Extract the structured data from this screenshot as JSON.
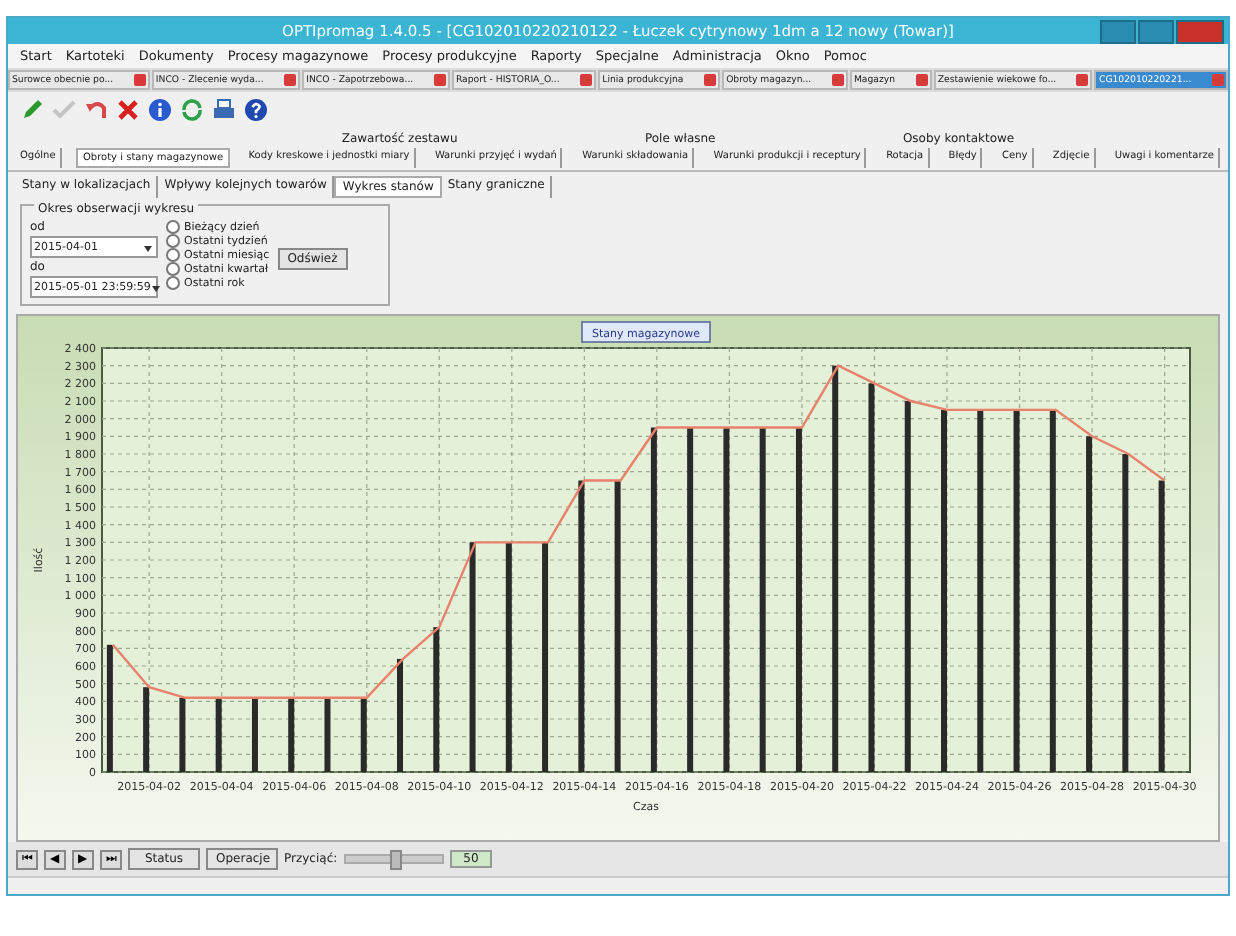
{
  "window": {
    "title": "OPTIpromag 1.4.0.5 - [CG102010220210122 - Łuczek cytrynowy 1dm a 12 nowy (Towar)]"
  },
  "menu": [
    "Start",
    "Kartoteki",
    "Dokumenty",
    "Procesy magazynowe",
    "Procesy produkcyjne",
    "Raporty",
    "Specjalne",
    "Administracja",
    "Okno",
    "Pomoc"
  ],
  "document_tabs": [
    {
      "label": "Surowce obecnie po...",
      "selected": false
    },
    {
      "label": "INCO - Zlecenie wyda...",
      "selected": false
    },
    {
      "label": "INCO - Zapotrzebowa...",
      "selected": false
    },
    {
      "label": "Raport - HISTORIA_O...",
      "selected": false
    },
    {
      "label": "Linia produkcyjna",
      "selected": false
    },
    {
      "label": "Obroty magazyn...",
      "selected": false
    },
    {
      "label": "Magazyn",
      "selected": false
    },
    {
      "label": "Zestawienie wiekowe fo...",
      "selected": false
    },
    {
      "label": "CG102010220221...",
      "selected": true
    }
  ],
  "toolbar": [
    {
      "kind": "edit",
      "disabled": false
    },
    {
      "kind": "accept",
      "disabled": true
    },
    {
      "kind": "undo",
      "disabled": false
    },
    {
      "kind": "delete",
      "disabled": false
    },
    {
      "kind": "info",
      "disabled": false
    },
    {
      "kind": "refresh",
      "disabled": false
    },
    {
      "kind": "print",
      "disabled": false
    },
    {
      "kind": "help",
      "disabled": false
    }
  ],
  "tab_groups": [
    "Zawartość zestawu",
    "Pole własne",
    "Osoby kontaktowe"
  ],
  "tabs": [
    {
      "label": "Ogólne",
      "selected": false
    },
    {
      "label": "Obroty i stany magazynowe",
      "selected": true
    },
    {
      "label": "Kody kreskowe i jednostki miary",
      "selected": false
    },
    {
      "label": "Warunki przyjęć i wydań",
      "selected": false
    },
    {
      "label": "Warunki składowania",
      "selected": false
    },
    {
      "label": "Warunki produkcji i receptury",
      "selected": false
    },
    {
      "label": "Rotacja",
      "selected": false
    },
    {
      "label": "Błędy",
      "selected": false
    },
    {
      "label": "Ceny",
      "selected": false
    },
    {
      "label": "Zdjęcie",
      "selected": false
    },
    {
      "label": "Uwagi i komentarze",
      "selected": false
    }
  ],
  "subtabs": [
    {
      "label": "Stany w lokalizacjach",
      "selected": false
    },
    {
      "label": "Wpływy kolejnych towarów",
      "selected": false
    },
    {
      "label": "Wykres stanów",
      "selected": true
    },
    {
      "label": "Stany graniczne",
      "selected": false
    }
  ],
  "period": {
    "title": "Okres obserwacji wykresu",
    "from_label": "od",
    "from": "2015-04-01",
    "to_label": "do",
    "to": "2015-05-01 23:59:59",
    "options": [
      {
        "label": "Bieżący dzień",
        "selected": false
      },
      {
        "label": "Ostatni tydzień",
        "selected": false
      },
      {
        "label": "Ostatni miesiąc",
        "selected": false
      },
      {
        "label": "Ostatni kwartał",
        "selected": false
      },
      {
        "label": "Ostatni rok",
        "selected": false
      }
    ],
    "button": "Odśwież"
  },
  "chart": {
    "chart_data": {
      "type": "bar",
      "title": "Stany magazynowe",
      "xlabel": "Czas",
      "ylabel": "Ilość",
      "categories": [
        null,
        "2015-04-02",
        null,
        "2015-04-04",
        null,
        "2015-04-06",
        null,
        "2015-04-08",
        null,
        "2015-04-10",
        null,
        "2015-04-12",
        null,
        "2015-04-14",
        null,
        "2015-04-16",
        null,
        "2015-04-18",
        null,
        "2015-04-20",
        null,
        "2015-04-22",
        null,
        "2015-04-24",
        null,
        "2015-04-26",
        null,
        "2015-04-28",
        null,
        "2015-04-30"
      ],
      "series": [
        {
          "type": "bar",
          "color": "#2a2a2a",
          "values": [
            720,
            480,
            420,
            420,
            420,
            420,
            420,
            420,
            640,
            820,
            1300,
            1300,
            1300,
            1650,
            1650,
            1950,
            1950,
            1950,
            1950,
            1950,
            2300,
            2200,
            2100,
            2050,
            2050,
            2050,
            2050,
            1900,
            1800,
            1650
          ]
        },
        {
          "type": "line",
          "color": "#e8806a",
          "values": [
            720,
            480,
            420,
            420,
            420,
            420,
            420,
            420,
            640,
            820,
            1300,
            1300,
            1300,
            1650,
            1650,
            1950,
            1950,
            1950,
            1950,
            1950,
            2300,
            2200,
            2100,
            2050,
            2050,
            2050,
            2050,
            1900,
            1800,
            1650
          ]
        }
      ],
      "ylim": [
        0,
        2400
      ],
      "grid": true,
      "yticks": [
        0,
        100,
        200,
        300,
        400,
        500,
        600,
        700,
        800,
        900,
        {
          "value": 1000,
          "label": "1 000"
        },
        {
          "value": 1100,
          "label": "1 100"
        },
        {
          "value": 1200,
          "label": "1 200"
        },
        {
          "value": 1300,
          "label": "1 300"
        },
        {
          "value": 1400,
          "label": "1 400"
        },
        {
          "value": 1500,
          "label": "1 500"
        },
        {
          "value": 1600,
          "label": "1 600"
        },
        {
          "value": 1700,
          "label": "1 700"
        },
        {
          "value": 1800,
          "label": "1 800"
        },
        {
          "value": 1900,
          "label": "1 900"
        },
        {
          "value": 2000,
          "label": "2 000"
        },
        {
          "value": 2100,
          "label": "2 100"
        },
        {
          "value": 2200,
          "label": "2 200"
        },
        {
          "value": 2300,
          "label": "2 300"
        },
        {
          "value": 2400,
          "label": "2 400"
        }
      ]
    }
  },
  "navigator": {
    "buttons": [
      "⏮",
      "◀",
      "▶",
      "⏭"
    ],
    "status_button": "Status",
    "operations_button": "Operacje",
    "zoom_label": "Przyciąć:",
    "zoom": {
      "level": 0.5
    },
    "zoom_value": "50"
  }
}
